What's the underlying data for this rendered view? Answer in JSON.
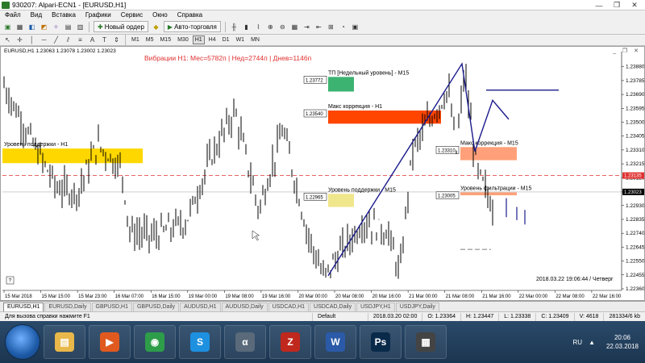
{
  "window": {
    "title": "930207: Alpari-ECN1 - [EURUSD,H1]",
    "min_glyph": "—",
    "max_glyph": "❐",
    "close_glyph": "✕"
  },
  "menu": [
    "Файл",
    "Вид",
    "Вставка",
    "Графики",
    "Сервис",
    "Окно",
    "Справка"
  ],
  "toolbar": {
    "new_order_label": "Новый ордер",
    "auto_trading_label": "Авто-торговля",
    "timeframes": [
      "M1",
      "M5",
      "M15",
      "M30",
      "H1",
      "H4",
      "D1",
      "W1",
      "MN"
    ],
    "active_timeframe": "H1"
  },
  "chart_window": {
    "title": "EURUSD,H1",
    "header_text": "Вибрации H1: Мес=5782п | Нед=2744п | Днев=1146п",
    "timestamp": "2018.03.22 19:06:44 / Четверг",
    "buttons": "_ ❐ ✕"
  },
  "chart_data": {
    "type": "candlestick",
    "title": "EURUSD,H1",
    "ohlc_header": "1.23063 1.23078 1.23002 1.23023",
    "y_ticks": [
      "1.23880",
      "1.23785",
      "1.23690",
      "1.23595",
      "1.23500",
      "1.23405",
      "1.23310",
      "1.23215",
      "1.23120",
      "1.23023",
      "1.22930",
      "1.22835",
      "1.22740",
      "1.22645",
      "1.22550",
      "1.22455",
      "1.22360"
    ],
    "ylim": [
      1.2236,
      1.2395
    ],
    "current_price": "1.23023",
    "alt_price": "1.23135",
    "x_ticks": [
      "15 Mar 2018",
      "15 Mar 15:00",
      "15 Mar 23:00",
      "16 Mar 07:00",
      "16 Mar 15:00",
      "19 Mar 00:00",
      "19 Mar 08:00",
      "19 Mar 16:00",
      "20 Mar 00:00",
      "20 Mar 08:00",
      "20 Mar 16:00",
      "21 Mar 00:00",
      "21 Mar 08:00",
      "21 Mar 16:00",
      "22 Mar 00:00",
      "22 Mar 08:00",
      "22 Mar 16:00"
    ],
    "zones": [
      {
        "label": "Уровень поддержки - H1",
        "price_top": 1.2332,
        "price_bottom": 1.2322,
        "color": "#ffd700"
      },
      {
        "label": "ТП [Недельный уровень] - M15",
        "price_top": 1.2381,
        "price_bottom": 1.2371,
        "color": "#3cb371",
        "price_tag": "1.23772"
      },
      {
        "label": "Макс коррекция - H1",
        "price_top": 1.2358,
        "price_bottom": 1.2349,
        "color": "#ff4500",
        "price_tag": "1.23540"
      },
      {
        "label": "Уровень поддержки - M15",
        "price_top": 1.2301,
        "price_bottom": 1.2292,
        "color": "#f0e68c",
        "price_tag": "1.22965"
      },
      {
        "label": "Макс коррекция - M15",
        "price_top": 1.2333,
        "price_bottom": 1.2324,
        "color": "#ffa07a",
        "price_tag": "1.23310"
      },
      {
        "label": "Уровень фильтрации - M15",
        "price_top": 1.2302,
        "price_bottom": 1.23,
        "color": "#ffa07a",
        "price_tag": "1.23005"
      }
    ]
  },
  "tabs": [
    "EURUSD,H1",
    "EURUSD,Daily",
    "GBPUSD,H1",
    "GBPUSD,Daily",
    "AUDUSD,H1",
    "AUDUSD,Daily",
    "USDCAD,H1",
    "USDCAD,Daily",
    "USDJPY,H1",
    "USDJPY,Daily"
  ],
  "active_tab": "EURUSD,H1",
  "status": {
    "help": "Для вызова справки нажмите F1",
    "profile": "Default",
    "time": "2018.03.20 02:00",
    "open": "O: 1.23364",
    "high": "H: 1.23447",
    "low": "L: 1.23338",
    "close": "C: 1.23409",
    "volume": "V: 4618",
    "traffic": "281334/6 kb"
  },
  "taskbar": {
    "apps": [
      {
        "name": "folder-icon",
        "color": "#e8b84a",
        "glyph": "▤"
      },
      {
        "name": "media-player-icon",
        "color": "#e05a20",
        "glyph": "▶"
      },
      {
        "name": "chrome-icon",
        "color": "#2e9d4a",
        "glyph": "◉"
      },
      {
        "name": "skype-icon",
        "color": "#1e90e0",
        "glyph": "S"
      },
      {
        "name": "alpari-icon",
        "color": "#5a6a7a",
        "glyph": "α"
      },
      {
        "name": "filezilla-icon",
        "color": "#c0281e",
        "glyph": "Z"
      },
      {
        "name": "word-icon",
        "color": "#2a5aa8",
        "glyph": "W"
      },
      {
        "name": "photoshop-icon",
        "color": "#0a2a4a",
        "glyph": "Ps"
      },
      {
        "name": "terminal-icon",
        "color": "#444444",
        "glyph": "▦"
      }
    ],
    "lang": "RU",
    "clock_time": "20:06",
    "clock_date": "22.03.2018"
  }
}
